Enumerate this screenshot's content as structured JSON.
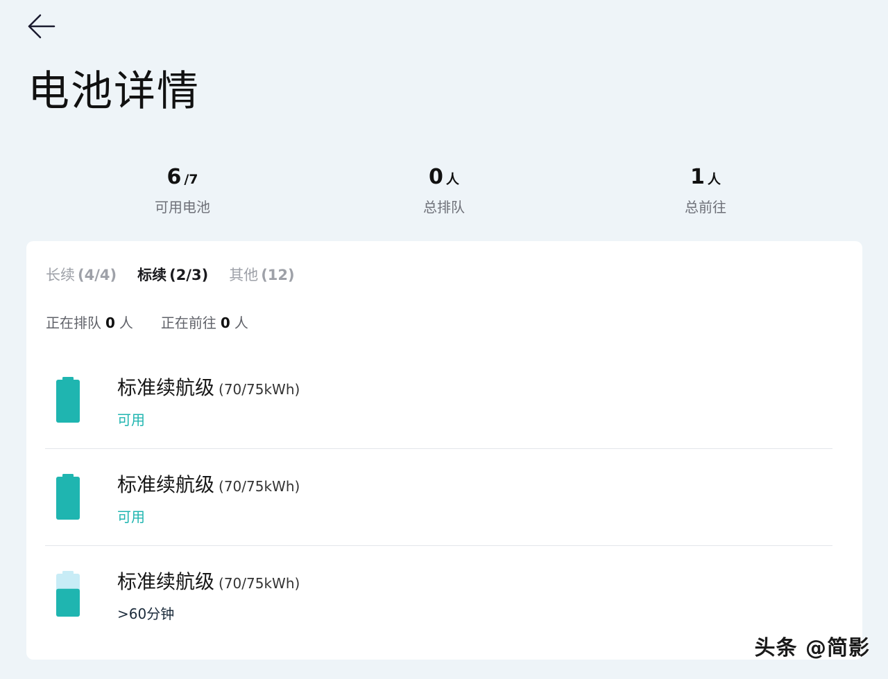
{
  "header": {
    "back_icon": "arrow-left-icon",
    "title": "电池详情"
  },
  "stats": [
    {
      "value": "6",
      "unit": "/7",
      "label": "可用电池"
    },
    {
      "value": "0",
      "unit": "人",
      "label": "总排队"
    },
    {
      "value": "1",
      "unit": "人",
      "label": "总前往"
    }
  ],
  "tabs": [
    {
      "label": "长续",
      "count": "(4/4)",
      "active": false
    },
    {
      "label": "标续",
      "count": "(2/3)",
      "active": true
    },
    {
      "label": "其他",
      "count": "(12)",
      "active": false
    }
  ],
  "queue": {
    "queuing_prefix": "正在排队",
    "queuing_count": "0",
    "queuing_suffix": "人",
    "heading_prefix": "正在前往",
    "heading_count": "0",
    "heading_suffix": "人"
  },
  "batteries": [
    {
      "name": "标准续航级",
      "spec": "(70/75kWh)",
      "status": "可用",
      "available": true,
      "charge_level": 1.0
    },
    {
      "name": "标准续航级",
      "spec": "(70/75kWh)",
      "status": "可用",
      "available": true,
      "charge_level": 1.0
    },
    {
      "name": "标准续航级",
      "spec": "(70/75kWh)",
      "status": ">60分钟",
      "available": false,
      "charge_level": 0.65
    }
  ],
  "colors": {
    "background": "#eef4f8",
    "card": "#ffffff",
    "accent": "#1fb5b0",
    "battery_empty": "#c8ecf6"
  },
  "watermark": "头条 @简影"
}
